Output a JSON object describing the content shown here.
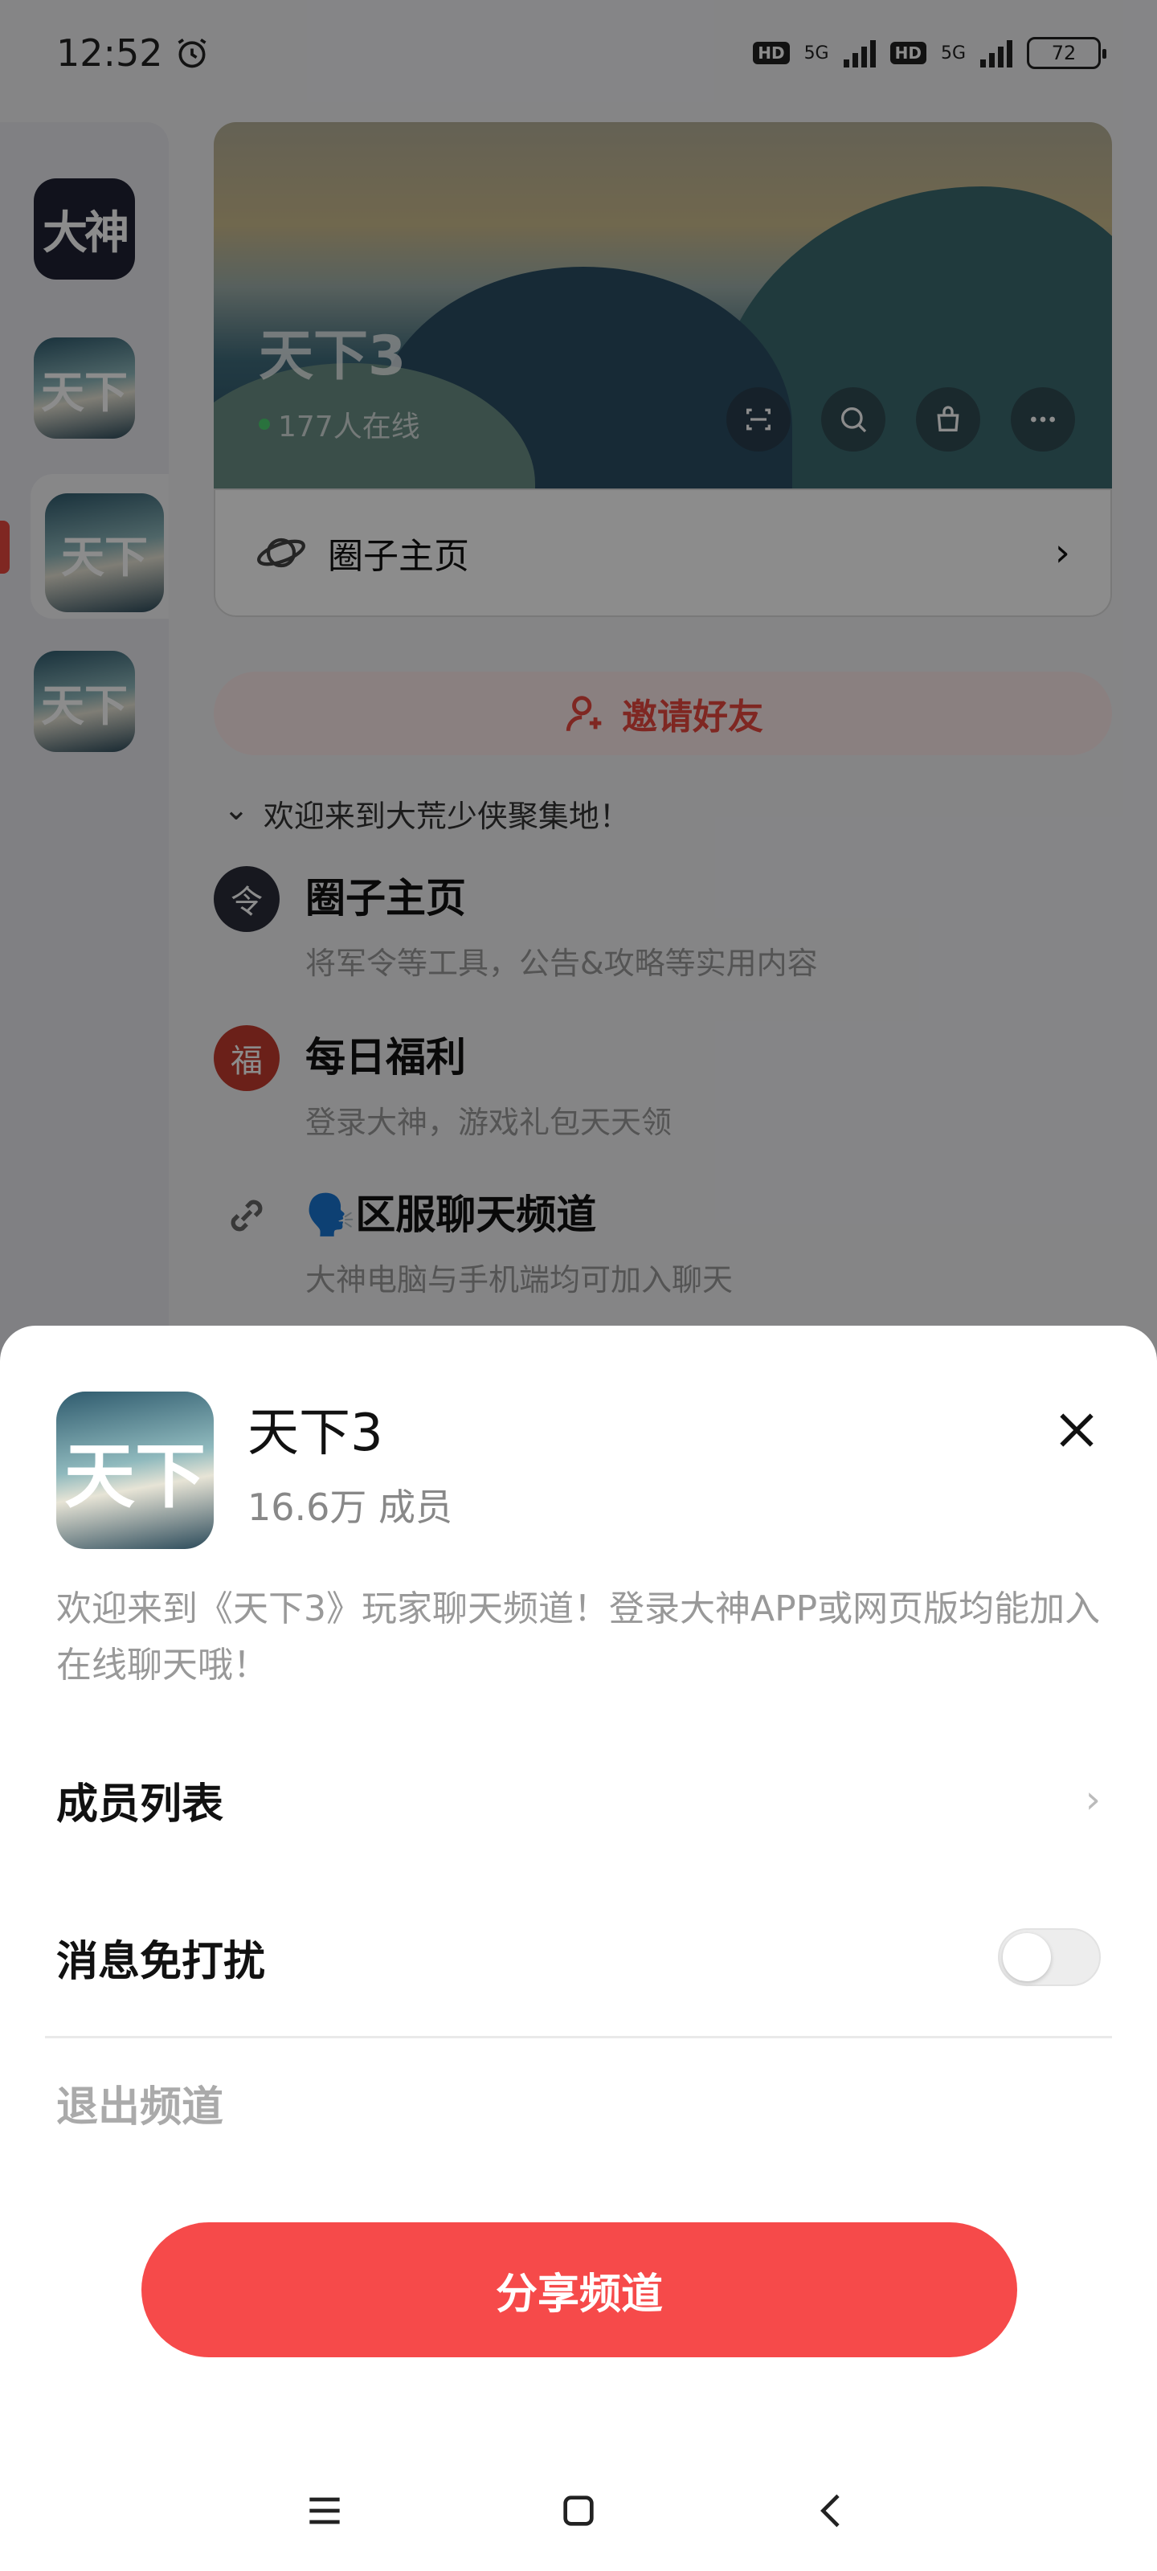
{
  "status_bar": {
    "time": "12:52",
    "hd1": "HD",
    "net1": "5G",
    "hd2": "HD",
    "net2": "5G",
    "battery": "72"
  },
  "sidebar": {
    "apps": [
      {
        "label": "大神"
      },
      {
        "label": "天下"
      },
      {
        "label": "天下"
      },
      {
        "label": "天下"
      }
    ]
  },
  "circle": {
    "title": "天下3",
    "online": "177人在线",
    "home_label": "圈子主页",
    "invite_label": "邀请好友",
    "welcome_text": "欢迎来到大荒少侠聚集地！",
    "channels": [
      {
        "title": "圈子主页",
        "desc": "将军令等工具，公告&攻略等实用内容"
      },
      {
        "title": "每日福利",
        "desc": "登录大神，游戏礼包天天领"
      },
      {
        "title": "🗣️区服聊天频道",
        "desc": "大神电脑与手机端均可加入聊天"
      }
    ]
  },
  "sheet": {
    "avatar_text": "天下",
    "name": "天下3",
    "members": "16.6万 成员",
    "description": "欢迎来到《天下3》玩家聊天频道！登录大神APP或网页版均能加入在线聊天哦！",
    "member_list_label": "成员列表",
    "dnd_label": "消息免打扰",
    "dnd_enabled": false,
    "leave_label": "退出频道",
    "share_label": "分享频道"
  },
  "colors": {
    "accent": "#f64a4a",
    "invite_bg": "#fbe9ea",
    "online_dot": "#4cd070"
  },
  "icons": [
    "alarm-icon",
    "signal-icon",
    "battery-icon",
    "scan-icon",
    "search-icon",
    "bag-icon",
    "more-icon",
    "planet-icon",
    "chevron-right-icon",
    "add-user-icon",
    "chevron-down-icon",
    "link-icon",
    "close-icon",
    "menu-icon",
    "home-icon",
    "back-icon"
  ]
}
